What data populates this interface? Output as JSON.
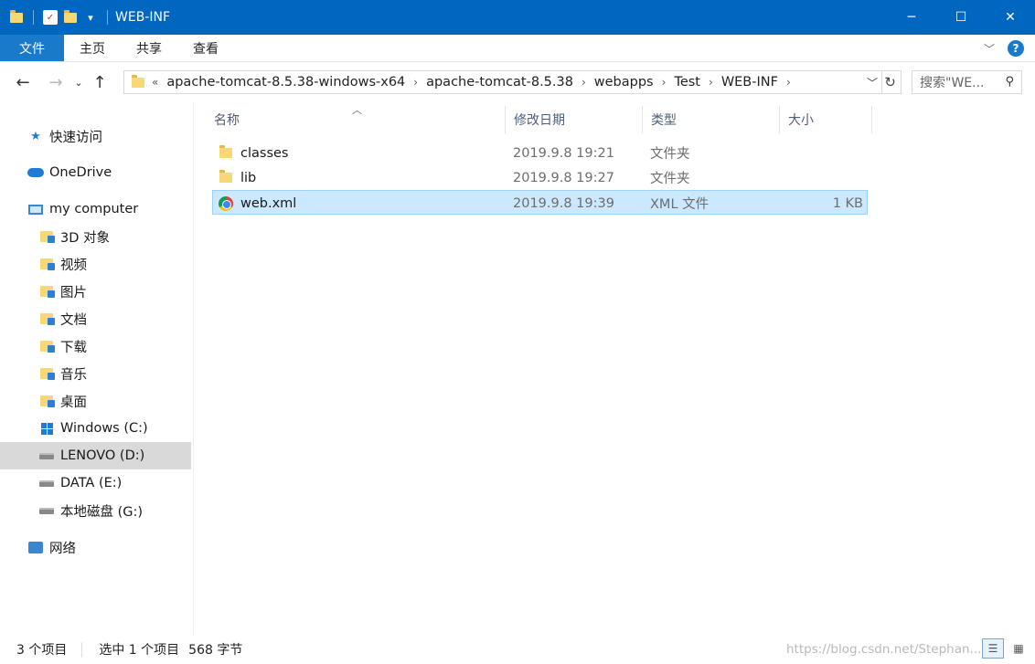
{
  "window": {
    "title": "WEB-INF",
    "controls": {
      "minimize": "─",
      "maximize": "☐",
      "close": "✕"
    }
  },
  "ribbon": {
    "tabs": [
      "文件",
      "主页",
      "共享",
      "查看"
    ],
    "help": "?"
  },
  "address": {
    "overflow": "«",
    "crumbs": [
      "apache-tomcat-8.5.38-windows-x64",
      "apache-tomcat-8.5.38",
      "webapps",
      "Test",
      "WEB-INF"
    ],
    "search_placeholder": "搜索\"WE..."
  },
  "nav": {
    "items": [
      {
        "label": "快速访问",
        "icon": "star-icon"
      },
      {
        "label": "OneDrive",
        "icon": "cloud-icon"
      },
      {
        "label": "my computer",
        "icon": "computer-icon"
      },
      {
        "label": "3D 对象",
        "icon": "folder-3d-icon"
      },
      {
        "label": "视频",
        "icon": "folder-video-icon"
      },
      {
        "label": "图片",
        "icon": "folder-pictures-icon"
      },
      {
        "label": "文档",
        "icon": "folder-documents-icon"
      },
      {
        "label": "下载",
        "icon": "folder-downloads-icon"
      },
      {
        "label": "音乐",
        "icon": "folder-music-icon"
      },
      {
        "label": "桌面",
        "icon": "folder-desktop-icon"
      },
      {
        "label": "Windows (C:)",
        "icon": "windows-drive-icon"
      },
      {
        "label": "LENOVO (D:)",
        "icon": "drive-icon"
      },
      {
        "label": "DATA (E:)",
        "icon": "drive-icon"
      },
      {
        "label": "本地磁盘 (G:)",
        "icon": "drive-icon"
      },
      {
        "label": "网络",
        "icon": "network-icon"
      }
    ],
    "selected": "LENOVO (D:)"
  },
  "columns": {
    "name": "名称",
    "date": "修改日期",
    "type": "类型",
    "size": "大小"
  },
  "files": [
    {
      "name": "classes",
      "date": "2019.9.8 19:21",
      "type": "文件夹",
      "size": "",
      "icon": "folder-icon"
    },
    {
      "name": "lib",
      "date": "2019.9.8 19:27",
      "type": "文件夹",
      "size": "",
      "icon": "folder-icon"
    },
    {
      "name": "web.xml",
      "date": "2019.9.8 19:39",
      "type": "XML 文件",
      "size": "1 KB",
      "icon": "chrome-icon",
      "selected": true
    }
  ],
  "status": {
    "count": "3 个项目",
    "selection": "选中 1 个项目",
    "size": "568 字节",
    "watermark": "https://blog.csdn.net/Stephan..."
  }
}
